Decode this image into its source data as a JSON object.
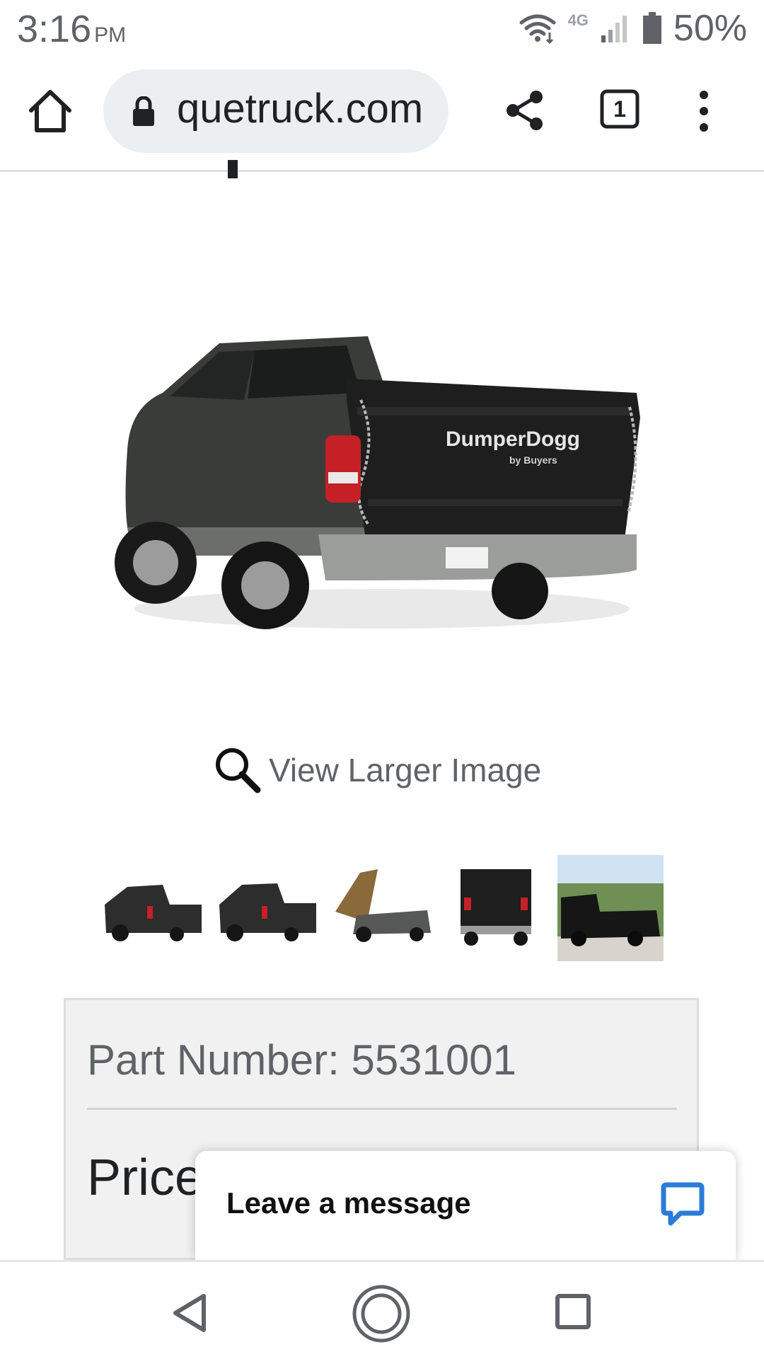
{
  "status_bar": {
    "time": "3:16",
    "ampm": "PM",
    "network_label": "4G",
    "battery": "50%",
    "icons": [
      "wifi-icon",
      "signal-icon",
      "battery-icon"
    ]
  },
  "browser": {
    "url": "quetruck.com",
    "tab_count": "1",
    "icons": [
      "home-icon",
      "lock-icon",
      "share-icon",
      "tab-switcher-icon",
      "more-vert-icon"
    ]
  },
  "product": {
    "image_brand_text": "DumperDogg",
    "image_brand_sub": "by Buyers",
    "view_larger_label": "View Larger Image",
    "thumbnail_count": 5,
    "part_number_label": "Part Number: 5531001",
    "price_label": "Price"
  },
  "chat": {
    "label": "Leave a message",
    "icon": "chat-bubble-icon",
    "accent_color": "#2a7cd8"
  },
  "nav_bar": {
    "icons": [
      "back-icon",
      "home-circle-icon",
      "recents-icon"
    ]
  }
}
